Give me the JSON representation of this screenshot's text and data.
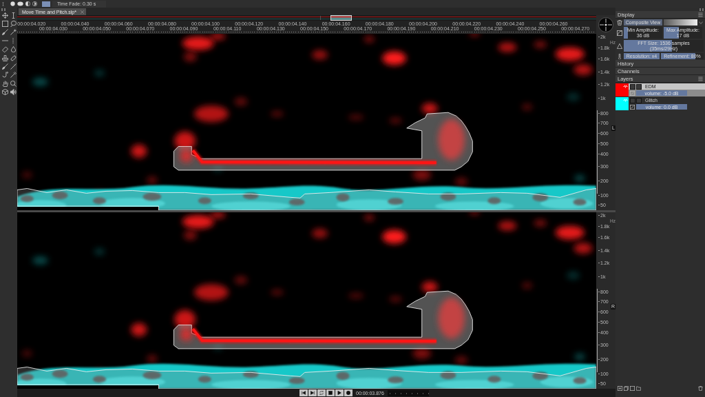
{
  "options_bar": {
    "time_fade": "Time Fade: 0.30 s"
  },
  "tabs": [
    {
      "label": "Move Time and Pitch.slp*",
      "selected": true
    }
  ],
  "timeline": {
    "ticks": [
      "00:00:04.020",
      "00:00:04.030",
      "00:00:04.040",
      "00:00:04.050",
      "00:00:04.060",
      "00:00:04.070",
      "00:00:04.080",
      "00:00:04.090",
      "00:00:04.100",
      "00:00:04.110",
      "00:00:04.120",
      "00:00:04.130",
      "00:00:04.140",
      "00:00:04.150",
      "00:00:04.160",
      "00:00:04.170",
      "00:00:04.180",
      "00:00:04.190",
      "00:00:04.200",
      "00:00:04.210",
      "00:00:04.220",
      "00:00:04.230",
      "00:00:04.240",
      "00:00:04.250",
      "00:00:04.260",
      "00:00:04.270"
    ]
  },
  "channels": [
    {
      "label": "L",
      "axis_unit": "Hz",
      "axis_labels": [
        "2k",
        "1.8k",
        "1.6k",
        "1.4k",
        "1.2k",
        "1k",
        "800",
        "700",
        "600",
        "500",
        "400",
        "300",
        "200",
        "100",
        "50"
      ]
    },
    {
      "label": "R",
      "axis_unit": "Hz",
      "axis_labels": [
        "2k",
        "1.8k",
        "1.6k",
        "1.4k",
        "1.2k",
        "1k",
        "800",
        "700",
        "600",
        "500",
        "400",
        "300",
        "200",
        "100",
        "50"
      ]
    }
  ],
  "display_panel": {
    "title": "Display",
    "view_button": "Composite View",
    "sliders": [
      {
        "label": "Min Amplitude: 36 dB",
        "level": 0.1
      },
      {
        "label": "Max Amplitude: 17 dB",
        "level": 0.4
      },
      {
        "label": "FFT Size: 1536 samples (35ms/29Hz)",
        "level": 0.6
      },
      {
        "label": "Resolution: x4",
        "level": 1
      },
      {
        "label": "Refinement: 80%",
        "level": 0.8
      }
    ]
  },
  "history_panel": {
    "title": "History"
  },
  "channels_panel": {
    "title": "Channels"
  },
  "layers_panel": {
    "title": "Layers",
    "layers": [
      {
        "name": "EDM",
        "color": "#ff0000",
        "selected": true,
        "volume": "volume: -5.0 dB"
      },
      {
        "name": "Glitch",
        "color": "#00ffff",
        "selected": false,
        "volume": "volume: 0.0 dB"
      }
    ]
  },
  "transport": {
    "time": "00:00:03.876"
  }
}
